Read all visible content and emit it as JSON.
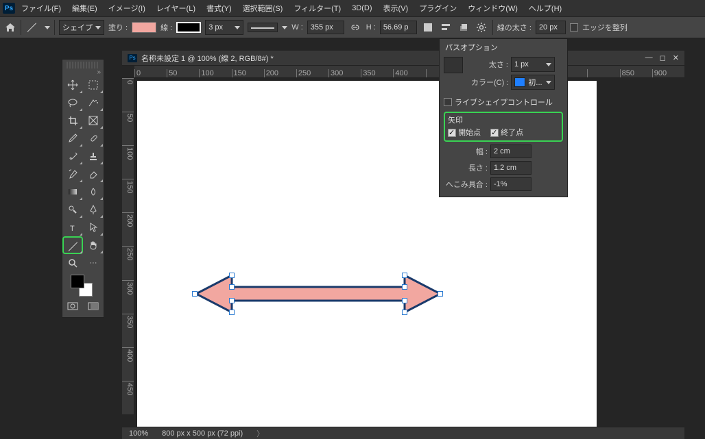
{
  "menubar": [
    "ファイル(F)",
    "編集(E)",
    "イメージ(I)",
    "レイヤー(L)",
    "書式(Y)",
    "選択範囲(S)",
    "フィルター(T)",
    "3D(D)",
    "表示(V)",
    "プラグイン",
    "ウィンドウ(W)",
    "ヘルプ(H)"
  ],
  "optbar": {
    "mode": "シェイプ",
    "fill_label": "塗り :",
    "stroke_label": "線 :",
    "stroke_width": "3 px",
    "w_label": "W :",
    "w_value": "355 px",
    "h_label": "H :",
    "h_value": "56.69 p",
    "weight_label": "線の太さ :",
    "weight_value": "20 px",
    "align_edges": "エッジを整列"
  },
  "doc": {
    "title": "名称未設定 1 @ 100% (線 2, RGB/8#) *",
    "zoom": "100%",
    "info": "800 px x 500 px (72 ppi)"
  },
  "ruler_h": [
    "0",
    "50",
    "100",
    "150",
    "200",
    "250",
    "300",
    "350",
    "400",
    "",
    "",
    "",
    "",
    "",
    "",
    "850",
    "900"
  ],
  "ruler_v": [
    "0",
    "50",
    "100",
    "150",
    "200",
    "250",
    "300",
    "350",
    "400",
    "450"
  ],
  "panel": {
    "title": "パスオプション",
    "thickness_label": "太さ :",
    "thickness_value": "1 px",
    "color_label": "カラー(C) :",
    "color_value": "初...",
    "live_shape": "ライブシェイプコントロール",
    "arrow_section": "矢印",
    "start_label": "開始点",
    "end_label": "終了点",
    "width_label": "幅 :",
    "width_value": "2 cm",
    "length_label": "長さ :",
    "length_value": "1.2 cm",
    "concave_label": "へこみ具合 :",
    "concave_value": "-1%"
  }
}
